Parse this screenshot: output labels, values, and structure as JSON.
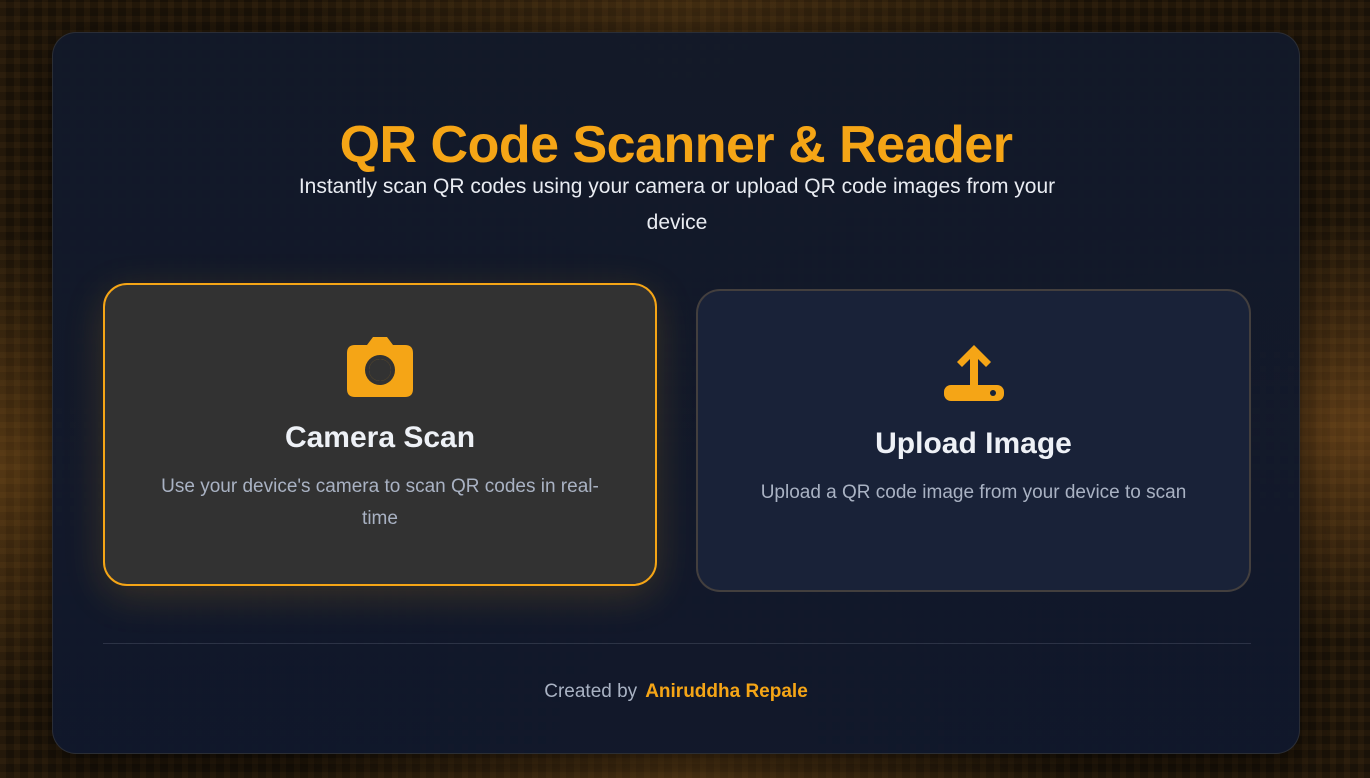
{
  "header": {
    "title": "QR Code Scanner & Reader",
    "subtitle": "Instantly scan QR codes using your camera or upload QR code images from your device"
  },
  "options": [
    {
      "icon": "camera-icon",
      "title": "Camera Scan",
      "description": "Use your device's camera to scan QR codes in real-time",
      "selected": true
    },
    {
      "icon": "upload-icon",
      "title": "Upload Image",
      "description": "Upload a QR code image from your device to scan",
      "selected": false
    }
  ],
  "footer": {
    "prefix": "Created by",
    "author": "Aniruddha Repale"
  },
  "colors": {
    "accent": "#f5a516",
    "card_background": "#12192a",
    "selected_option_background": "#323232",
    "option_background": "#192238"
  }
}
